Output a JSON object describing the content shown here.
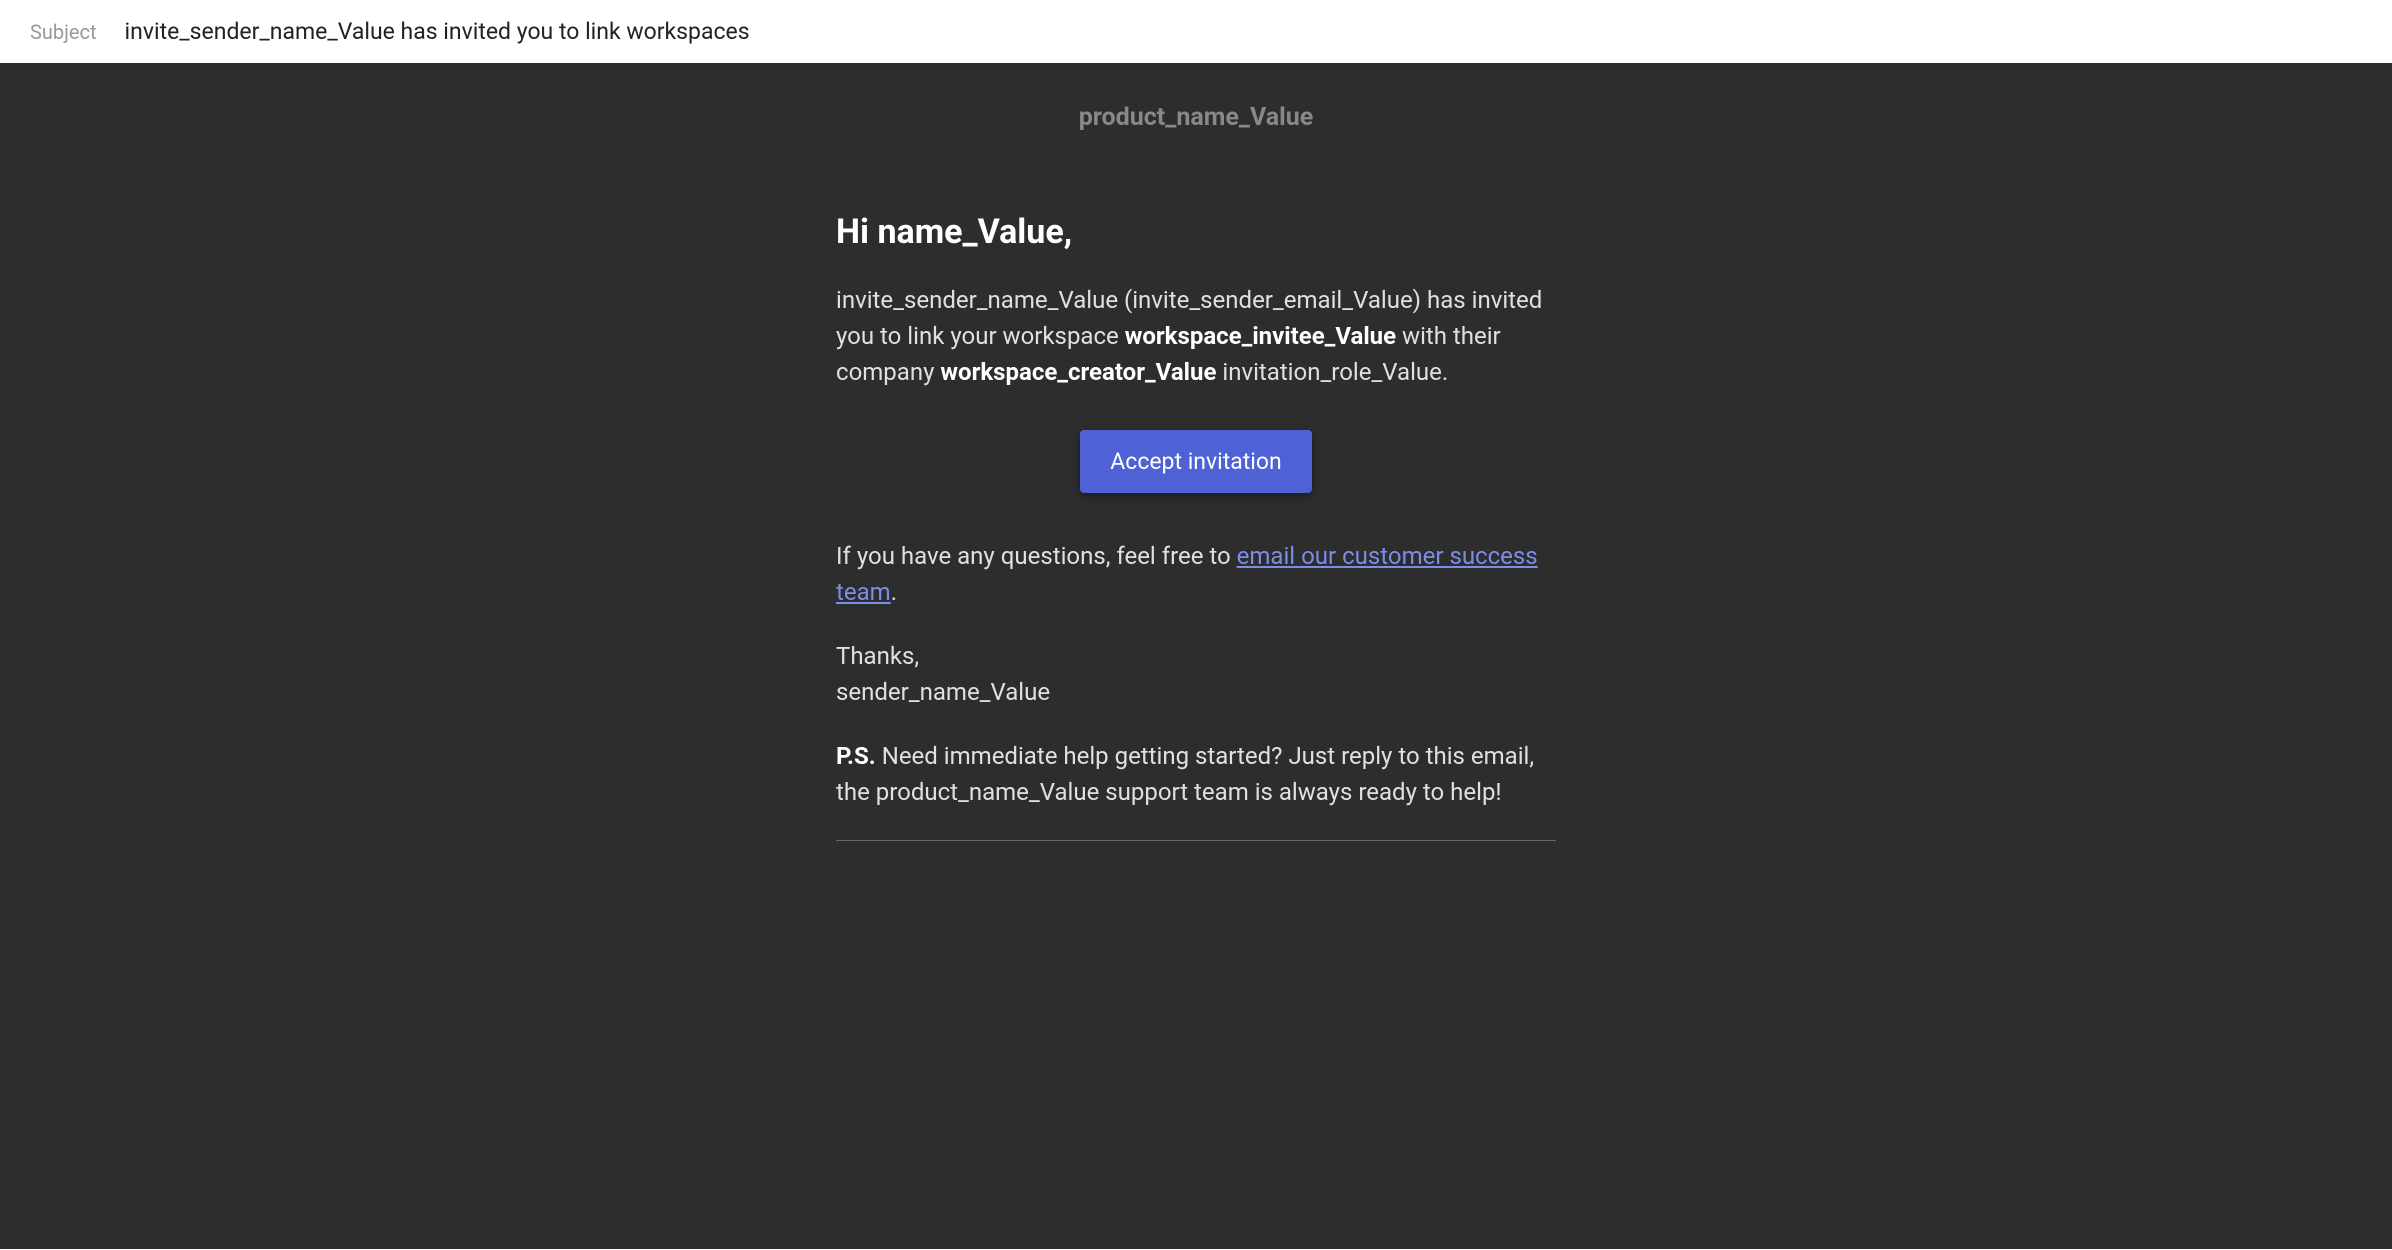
{
  "header": {
    "subject_label": "Subject",
    "subject_text": "invite_sender_name_Value has invited you to link workspaces"
  },
  "email": {
    "product_name": "product_name_Value",
    "greeting_prefix": "Hi ",
    "greeting_name": "name_Value",
    "greeting_suffix": ",",
    "invite_para_1_a": "invite_sender_name_Value (invite_sender_email_Value) has invited you to link your workspace ",
    "workspace_invitee": "workspace_invitee_Value",
    "invite_para_1_b": " with their company ",
    "workspace_creator": "workspace_creator_Value",
    "invite_para_1_c": " invitation_role_Value.",
    "button_label": "Accept invitation",
    "questions_prefix": "If you have any questions, feel free to ",
    "questions_link": "email our customer success team",
    "questions_suffix": ".",
    "thanks": "Thanks,",
    "sender_name": "sender_name_Value",
    "ps_label": "P.S.",
    "ps_text": " Need immediate help getting started? Just reply to this email, the product_name_Value support team is always ready to help!"
  }
}
